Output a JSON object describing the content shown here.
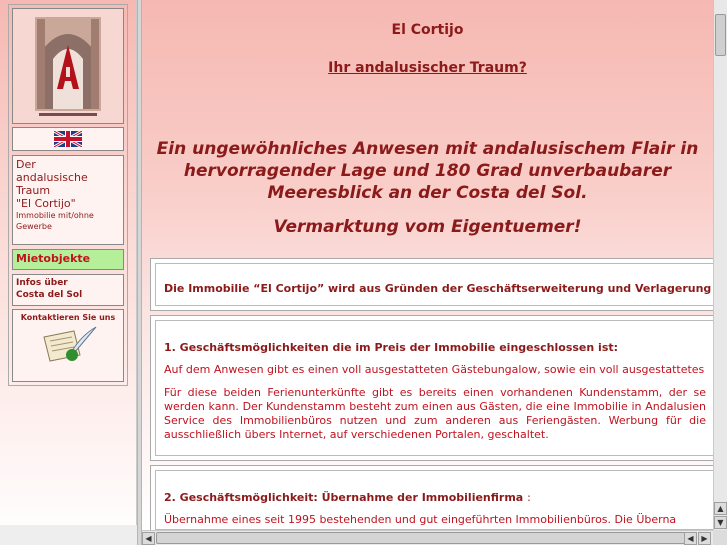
{
  "sidebar": {
    "logo_alt": "El Cortijo logo",
    "flag_language": "English",
    "traum_title_line1": "Der",
    "traum_title_line2": "andalusische",
    "traum_title_line3": "Traum",
    "traum_title_line4": "\"El Cortijo\"",
    "traum_sub": "Immobilie mit/ohne Gewerbe",
    "mietobjekte": "Mietobjekte",
    "infos_line1": "Infos über",
    "infos_line2": "Costa del Sol",
    "kontakt": "Kontaktieren Sie uns"
  },
  "main": {
    "title": "El Cortijo",
    "subtitle": "Ihr andalusischer Traum?",
    "tagline": "Ein ungewöhnliches Anwesen mit andalusischem Flair in hervorragender Lage und 180 Grad unverbaubarer Meeresblick an der Costa del Sol.",
    "vermarktung": "Vermarktung vom Eigentuemer!",
    "intro": "Die Immobilie “El Cortijo” wird aus Gründen der Geschäftserweiterung und Verlagerung",
    "section1_heading": "1. Geschäftsmöglichkeiten die im Preis der Immobilie eingeschlossen ist:",
    "section1_p1": "Auf dem Anwesen gibt es einen voll ausgestatteten Gästebungalow, sowie ein voll ausgestattetes",
    "section1_p2": "Für diese beiden Ferienunterkünfte gibt es bereits einen vorhandenen Kundenstamm, der se werden kann. Der Kundenstamm besteht zum einen aus Gästen, die eine Immobilie in Andalusien Service des Immobilienbüros nutzen und zum anderen aus Feriengästen. Werbung für die ausschließlich übers Internet, auf verschiedenen Portalen, geschaltet.",
    "section2_heading": "2. Geschäftsmöglichkeit: Übernahme der Immobilienfirma",
    "section2_colon": ":",
    "section2_p1": "Übernahme eines seit 1995 bestehenden und gut eingeführten Immobilienbüros. Die Überna"
  },
  "colors": {
    "brand_dark_red": "#8b1a1a",
    "text_red": "#c0121f",
    "miet_green": "#b6ef9a"
  }
}
